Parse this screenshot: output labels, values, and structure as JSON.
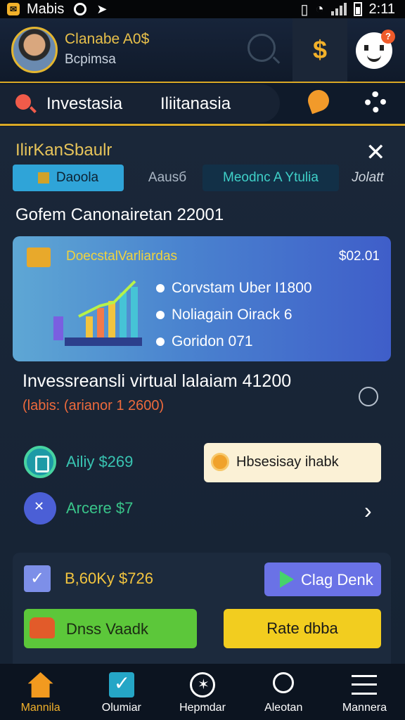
{
  "status_bar": {
    "carrier": "Mabis",
    "time": "2:11"
  },
  "header": {
    "user_name": "Clanabe A0$",
    "user_sub": "Bcpimsa"
  },
  "tabs": [
    "Investasia",
    "Iliitanasia"
  ],
  "main": {
    "title": "IlirKanSbaulr",
    "segments": [
      "Daoola",
      "Aausб",
      "Meodnc A Ytulia",
      "Jolatt"
    ],
    "section_heading": "Gofem Canonairetan 22001",
    "card": {
      "label": "DoecstalVarliardas",
      "amount": "$02.01",
      "stats": [
        "Corvstam Uber I1800",
        "Noliagain Oirack 6",
        "Goridon 071"
      ]
    },
    "investment_line": "Invessreansli virtual lalaiam 41200",
    "red_line": "(labis: (arianor 1 2600)",
    "balance1": "Ailiy $269",
    "balance2": "Arcere $7",
    "hb_button": "Hbsesisay ihabk",
    "card2": {
      "balance": "B,60Ky $726",
      "day_button": "Clag Denk",
      "green_button": "Dnss Vaadk",
      "yellow_button": "Rate dbba"
    }
  },
  "bottom_nav": [
    "Mannila",
    "Olumiar",
    "Hepmdar",
    "Aleotan",
    "Mannera"
  ],
  "colors": {
    "accent_gold": "#d9a825",
    "panel_bg": "#16202f",
    "red_text": "#ee6a3c"
  }
}
